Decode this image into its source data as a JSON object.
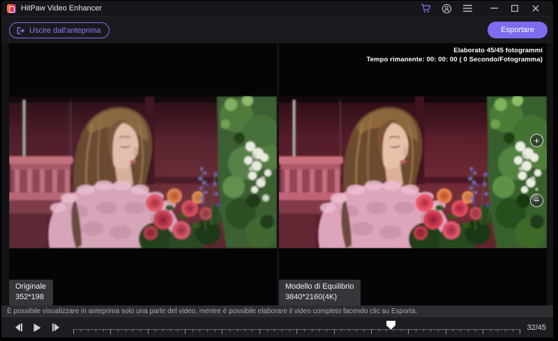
{
  "titlebar": {
    "title": "HitPaw Video Enhancer"
  },
  "toolbar": {
    "exit_preview": "Uscire dall'anteprima",
    "export": "Esportare"
  },
  "progress": {
    "line1": "Elaborato 45/45 fotogrammi",
    "line2": "Tempo rimanente: 00: 00: 00 ( 0 Secondo/Fotogramma)"
  },
  "panels": {
    "original": {
      "label": "Originale",
      "resolution": "352*198"
    },
    "enhanced": {
      "label": "Modello di Equilibrio",
      "resolution": "3840*2160(4K)"
    }
  },
  "zoom_controls": {
    "zoom_in_label": "+",
    "zoom_out_label": "−"
  },
  "statusbar": {
    "message": "È possibile visualizzare in anteprima solo una parte del video, mentre è possibile elaborare il video completo facendo clic su Esporta."
  },
  "playback": {
    "frame_counter": "32/45",
    "current_frame": 32,
    "total_frames": 45
  },
  "colors": {
    "accent_purple": "#8d7ef5",
    "export_button_bg": "#7d6bf0",
    "titlebar_bg": "#17171b",
    "statusbar_bg": "#2c2c31",
    "playback_bg": "#1d1d22",
    "panel_bg": "#050507"
  }
}
